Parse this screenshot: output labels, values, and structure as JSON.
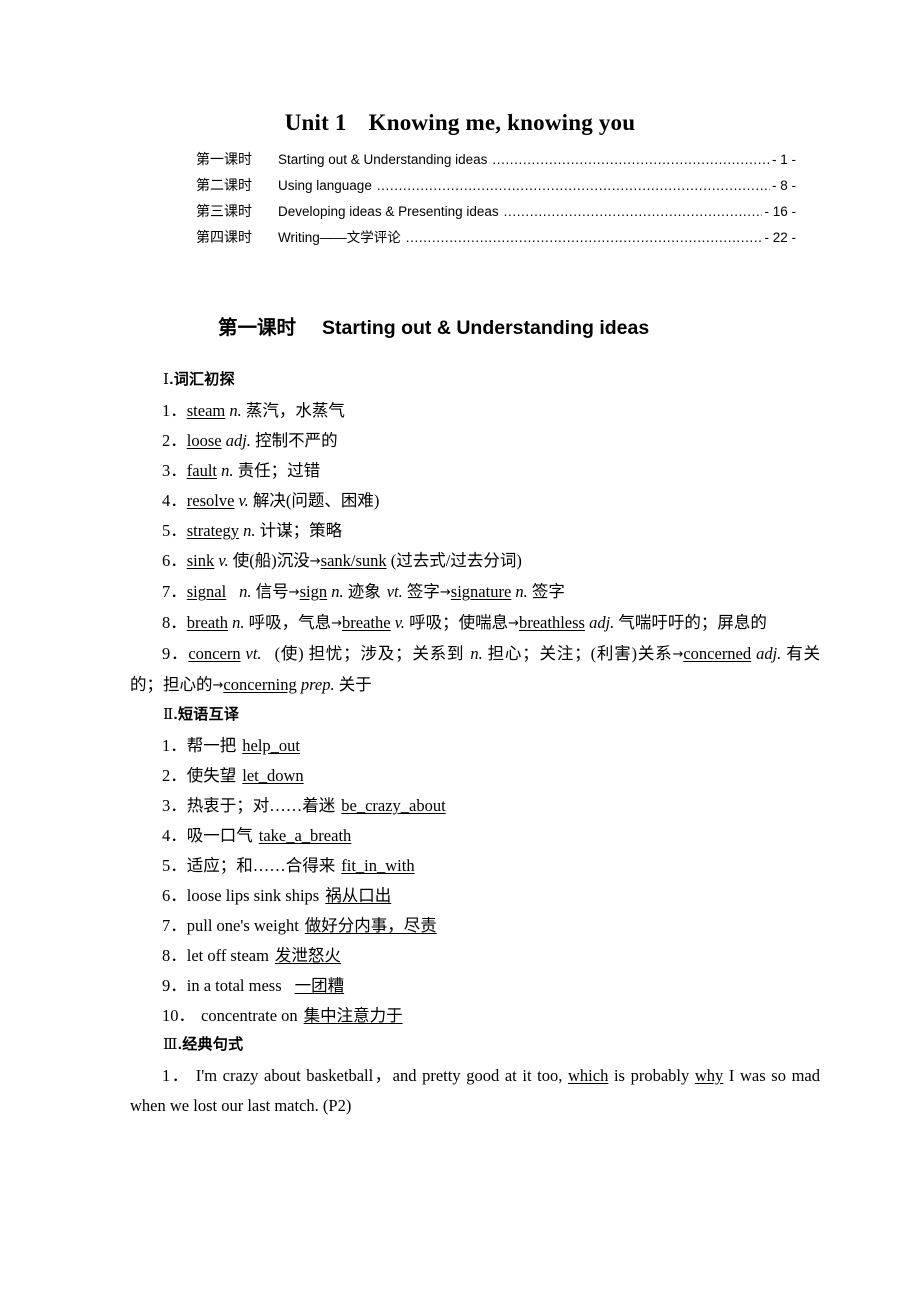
{
  "title": {
    "unit_label": "Unit 1",
    "unit_name": "Knowing me, knowing you"
  },
  "toc": {
    "rows": [
      {
        "lesson": "第一课时",
        "title": "Starting out & Understanding ideas",
        "page": "- 1 -"
      },
      {
        "lesson": "第二课时",
        "title": "Using language",
        "page": "- 8 -"
      },
      {
        "lesson": "第三课时",
        "title": "Developing ideas & Presenting ideas",
        "page": "- 16 -"
      },
      {
        "lesson": "第四课时",
        "title": "Writing——文学评论",
        "page": "- 22 -"
      }
    ]
  },
  "lesson_heading": {
    "cn": "第一课时",
    "en": "Starting out & Understanding ideas"
  },
  "sections": {
    "vocab": {
      "numeral": "Ⅰ",
      "dot": ".",
      "name": "词汇初探",
      "items": {
        "i1": {
          "num": "1．",
          "word": "steam",
          "pos": "n.",
          "def": "蒸汽，水蒸气"
        },
        "i2": {
          "num": "2．",
          "word": "loose",
          "pos": "adj.",
          "def": "控制不严的"
        },
        "i3": {
          "num": "3．",
          "word": "fault",
          "pos": "n.",
          "def": "责任；过错"
        },
        "i4": {
          "num": "4．",
          "word": "resolve",
          "pos": "v.",
          "def": "解决(问题、困难)"
        },
        "i5": {
          "num": "5．",
          "word": "strategy",
          "pos": "n.",
          "def": "计谋；策略"
        },
        "i6": {
          "num": "6．",
          "word": "sink",
          "pos": "v.",
          "def": "使(船)沉没",
          "derived": "sank/sunk",
          "tail": "(过去式/过去分词)"
        },
        "i7": {
          "num": "7．",
          "word": "signal",
          "pos": "n.",
          "def": "信号",
          "d1": "sign",
          "d1pos": "n.",
          "d1def": "迹象",
          "d1pos2": "vt.",
          "d1def2": "签字",
          "d2": "signature",
          "d2pos": "n.",
          "d2def": "签字"
        },
        "i8": {
          "num": "8．",
          "word": "breath",
          "pos": "n.",
          "def": "呼吸，气息",
          "d1": "breathe",
          "d1pos": "v.",
          "d1def": "呼吸；使喘息",
          "d2": "breathless",
          "d2pos": "adj.",
          "d2def": "气喘吁吁的；屏息的"
        },
        "i9": {
          "num": "9．",
          "word": "concern",
          "pos": "vt.",
          "def": "(使) 担忧；涉及；关系到",
          "pos2": "n.",
          "def2": "担心；关注；(利害)关系",
          "d1": "concerned",
          "d1pos": "adj.",
          "d1def": "有关的；担心的",
          "d2": "concerning",
          "d2pos": "prep.",
          "d2def": "关于"
        }
      }
    },
    "phrases": {
      "numeral": "Ⅱ",
      "dot": ".",
      "name": "短语互译",
      "items": [
        {
          "num": "1．",
          "prompt": "帮一把",
          "answer": "help_out"
        },
        {
          "num": "2．",
          "prompt": "使失望",
          "answer": "let_down"
        },
        {
          "num": "3．",
          "prompt": "热衷于；对……着迷",
          "answer": "be_crazy_about"
        },
        {
          "num": "4．",
          "prompt": "吸一口气",
          "answer": "take_a_breath"
        },
        {
          "num": "5．",
          "prompt": "适应；和……合得来",
          "answer": "fit_in_with"
        },
        {
          "num": "6．",
          "prompt": "loose lips sink ships",
          "answer": "祸从口出"
        },
        {
          "num": "7．",
          "prompt": "pull one's weight",
          "answer": "做好分内事，尽责"
        },
        {
          "num": "8．",
          "prompt": "let off steam",
          "answer": "发泄怒火"
        },
        {
          "num": "9．",
          "prompt": "in a total mess",
          "answer": "一团糟"
        },
        {
          "num": "10．",
          "prompt": "concentrate on",
          "answer": "集中注意力于"
        }
      ]
    },
    "sentences": {
      "numeral": "Ⅲ",
      "dot": ".",
      "name": "经典句式",
      "items": [
        {
          "num": "1．",
          "part1": "I'm crazy about basketball，and pretty good at it too, ",
          "key1": "which",
          "part2": " is probably ",
          "key2": "why",
          "part3": " I was so mad when we lost our last match. (P2)"
        }
      ]
    }
  }
}
